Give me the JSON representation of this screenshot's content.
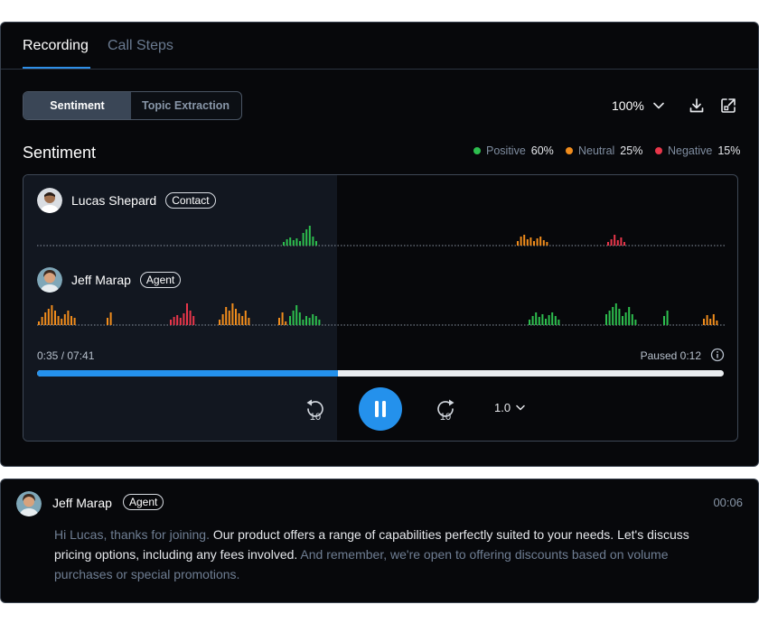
{
  "tabs": [
    {
      "label": "Recording",
      "active": true
    },
    {
      "label": "Call Steps",
      "active": false
    }
  ],
  "view_toggle": {
    "options": [
      "Sentiment",
      "Topic Extraction"
    ],
    "selected": "Sentiment"
  },
  "toolbar": {
    "zoom": "100%",
    "icons": [
      "chevron-down-icon",
      "download-icon",
      "expand-icon"
    ]
  },
  "section_title": "Sentiment",
  "legend": {
    "positive": {
      "label": "Positive",
      "value": "60%",
      "color": "#2dbe4e"
    },
    "neutral": {
      "label": "Neutral",
      "value": "25%",
      "color": "#f08c1c"
    },
    "negative": {
      "label": "Negative",
      "value": "15%",
      "color": "#e8364a"
    }
  },
  "speakers": [
    {
      "name": "Lucas Shepard",
      "role": "Contact"
    },
    {
      "name": "Jeff Marap",
      "role": "Agent"
    }
  ],
  "player": {
    "time": "0:35 / 07:41",
    "paused": "Paused 0:12",
    "progress": 0.438,
    "speed": "1.0",
    "rewind_seconds": "10",
    "forward_seconds": "10"
  },
  "transcript": {
    "speaker": "Jeff Marap",
    "role": "Agent",
    "timestamp": "00:06",
    "segments": [
      {
        "text": "Hi Lucas, thanks for joining. ",
        "muted": true
      },
      {
        "text": "Our product offers a range of capabilities perfectly suited to your needs. Let's discuss pricing options, including any fees involved.",
        "muted": false
      },
      {
        "text": " And remember, we're open to offering discounts based on volume purchases or special promotions.",
        "muted": true
      }
    ]
  }
}
